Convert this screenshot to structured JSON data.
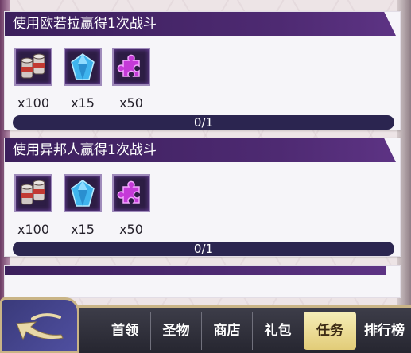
{
  "tasks": [
    {
      "title": "使用欧若拉赢得1次战斗",
      "rewards": [
        {
          "icon": "supply-cans-icon",
          "qty": "x100"
        },
        {
          "icon": "blue-crystal-icon",
          "qty": "x15"
        },
        {
          "icon": "purple-puzzle-piece-icon",
          "qty": "x50"
        }
      ],
      "progress_text": "0/1",
      "progress_fraction": 0
    },
    {
      "title": "使用异邦人赢得1次战斗",
      "rewards": [
        {
          "icon": "supply-cans-icon",
          "qty": "x100"
        },
        {
          "icon": "blue-crystal-icon",
          "qty": "x15"
        },
        {
          "icon": "purple-puzzle-piece-icon",
          "qty": "x50"
        }
      ],
      "progress_text": "0/1",
      "progress_fraction": 0
    }
  ],
  "nav": {
    "back_icon": "back-arrow-icon",
    "tabs": [
      "首领",
      "圣物",
      "商店",
      "礼包",
      "任务",
      "排行榜"
    ],
    "active_tab": "任务"
  },
  "colors": {
    "header": "#3b1f5c",
    "progress_track": "#2b2550",
    "active_tab": "#efe0a0"
  }
}
